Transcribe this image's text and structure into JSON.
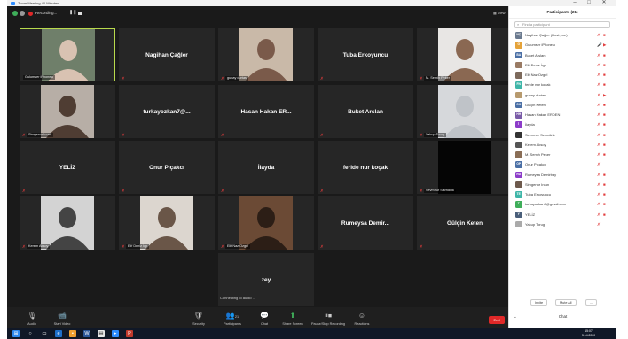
{
  "window": {
    "title": "Zoom Meeting 40 Minutes"
  },
  "meeting": {
    "recording_label": "Recording...",
    "view_label": "View",
    "connecting_text": "Connecting to audio ..."
  },
  "tiles": [
    {
      "name": "Gulumser iPhone'u",
      "type": "photo",
      "label": "Gulumser iPhone'u",
      "muted": false,
      "active": true
    },
    {
      "name": "Nagihan Çağler",
      "type": "text",
      "label": "",
      "muted": true
    },
    {
      "name": "gunay durtas",
      "type": "photo",
      "label": "gunay durtas",
      "muted": true
    },
    {
      "name": "Tuba Erkoyuncu",
      "type": "text",
      "label": "",
      "muted": true
    },
    {
      "name": "M. Semih Peker",
      "type": "photo",
      "label": "M. Semih Peker",
      "muted": true
    },
    {
      "name": "Simgenur Ircan",
      "type": "photo",
      "label": "Simgenur Ircan",
      "muted": true
    },
    {
      "name": "turkayozkan7@...",
      "type": "text",
      "label": "",
      "muted": true
    },
    {
      "name": "Hasan Hakan ER...",
      "type": "text",
      "label": "",
      "muted": true
    },
    {
      "name": "Buket Arslan",
      "type": "text",
      "label": "",
      "muted": true
    },
    {
      "name": "Yakup Torug",
      "type": "placeholder",
      "label": "Yakup Torug",
      "muted": true
    },
    {
      "name": "YELİZ",
      "type": "text",
      "label": "",
      "muted": true
    },
    {
      "name": "Onur Pıçakcı",
      "type": "text",
      "label": "",
      "muted": true
    },
    {
      "name": "İlayda",
      "type": "text",
      "label": "",
      "muted": true
    },
    {
      "name": "feride nur koçak",
      "type": "text",
      "label": "",
      "muted": true
    },
    {
      "name": "Sevmnur Sevndirik",
      "type": "black",
      "label": "Sevmnur Sevndirik",
      "muted": true
    },
    {
      "name": "Kerem Aksoy",
      "type": "photo",
      "label": "Kerem Aksoy",
      "muted": true
    },
    {
      "name": "Elif Deniz İçp",
      "type": "photo",
      "label": "Elif Deniz İçp",
      "muted": true
    },
    {
      "name": "Elif Naz Ozgel",
      "type": "photo",
      "label": "Elif Naz Ozgel",
      "muted": true
    },
    {
      "name": "Rumeysa Demir...",
      "type": "text",
      "label": "",
      "muted": true
    },
    {
      "name": "Gülçin Keten",
      "type": "text",
      "label": "",
      "muted": true
    },
    {
      "name": "zey",
      "type": "text",
      "label": "",
      "muted": false
    }
  ],
  "toolbar": {
    "audio": "Audio",
    "video": "Start Video",
    "security": "Security",
    "participants": "Participants",
    "participants_count": "21",
    "chat": "Chat",
    "share": "Share Screen",
    "record": "Pause/Stop Recording",
    "reactions": "Reactions",
    "end": "End"
  },
  "panel": {
    "title": "Participants (21)",
    "search_placeholder": "Find a participant",
    "invite": "Invite",
    "mute_all": "Mute All",
    "more": "...",
    "chat_label": "Chat"
  },
  "participants": [
    {
      "initials": "NÇ",
      "name": "Nagihan Çağler (Host, me)",
      "color": "#6b7a8f",
      "mic": "✗",
      "cam": "■"
    },
    {
      "initials": "G",
      "name": "Gulumser iPhone'u",
      "color": "#e5a33a",
      "mic": "🎤",
      "cam": "▶"
    },
    {
      "initials": "BA",
      "name": "Buket Arslan",
      "color": "#4a6fa5",
      "mic": "✗",
      "cam": "■"
    },
    {
      "initials": "",
      "name": "Elif Deniz İçp",
      "color": "#9a7b64",
      "mic": "✗",
      "cam": "■"
    },
    {
      "initials": "",
      "name": "Elif Naz Ozgel",
      "color": "#7d6a5c",
      "mic": "✗",
      "cam": "■"
    },
    {
      "initials": "FN",
      "name": "feride nur koçak",
      "color": "#3fb6a8",
      "mic": "✗",
      "cam": "■"
    },
    {
      "initials": "",
      "name": "gunay durtas",
      "color": "#b79a6e",
      "mic": "✗",
      "cam": "▶"
    },
    {
      "initials": "GK",
      "name": "Gülçin Keten",
      "color": "#4a6fa5",
      "mic": "✗",
      "cam": "■"
    },
    {
      "initials": "HH",
      "name": "Hasan Hakan ERDEN",
      "color": "#7a5ca8",
      "mic": "✗",
      "cam": "■"
    },
    {
      "initials": "İ",
      "name": "İlayda",
      "color": "#8c3cc9",
      "mic": "✗",
      "cam": "■"
    },
    {
      "initials": "",
      "name": "Sevmnur Sevndirik",
      "color": "#333333",
      "mic": "✗",
      "cam": "■"
    },
    {
      "initials": "",
      "name": "Kerem Aksoy",
      "color": "#555555",
      "mic": "✗",
      "cam": "■"
    },
    {
      "initials": "",
      "name": "M. Semih Peker",
      "color": "#8a6e56",
      "mic": "✗",
      "cam": "■"
    },
    {
      "initials": "OP",
      "name": "Onur Pıçakcı",
      "color": "#4a6fa5",
      "mic": "✗",
      "cam": ""
    },
    {
      "initials": "RD",
      "name": "Rumeysa Demirbay",
      "color": "#8c3cc9",
      "mic": "✗",
      "cam": "■"
    },
    {
      "initials": "",
      "name": "Simgenur Ircan",
      "color": "#6e5a4d",
      "mic": "✗",
      "cam": "■"
    },
    {
      "initials": "TE",
      "name": "Tuba Erkoyuncu",
      "color": "#3fb6a8",
      "mic": "✗",
      "cam": "■"
    },
    {
      "initials": "T",
      "name": "turkayozkan7@gmail.com",
      "color": "#3fae5a",
      "mic": "✗",
      "cam": "■"
    },
    {
      "initials": "Y",
      "name": "YELİZ",
      "color": "#4a5f7a",
      "mic": "✗",
      "cam": "■"
    },
    {
      "initials": "",
      "name": "Yakup Torug",
      "color": "#aaaaaa",
      "mic": "✗",
      "cam": ""
    }
  ],
  "taskbar": {
    "time": "15:07",
    "date": "5.14.2020"
  }
}
